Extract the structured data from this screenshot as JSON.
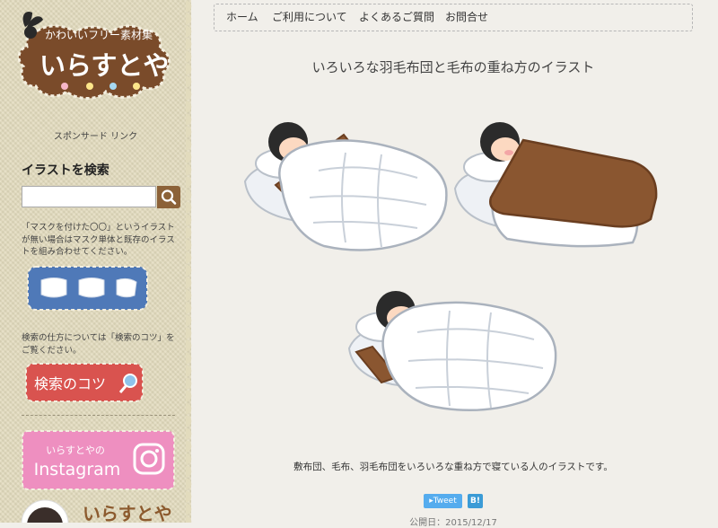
{
  "sidebar": {
    "logo": {
      "tagline": "かわいいフリー素材集",
      "title": "いらすとや"
    },
    "sponsored_link": "スポンサード リンク",
    "search_heading": "イラストを検索",
    "search_placeholder": "",
    "mask_note": "「マスクを付けた〇〇」というイラストが無い場合はマスク単体と既存のイラストを組み合わせてください。",
    "search_tip_note": "検索の仕方については「検索のコツ」をご覧ください。",
    "kotsu_banner": "検索のコツ",
    "instagram_banner": {
      "subtitle": "いらすとやの",
      "title": "Instagram"
    },
    "profile_banner": "いらすとや"
  },
  "nav": {
    "items": [
      {
        "label": "ホーム"
      },
      {
        "label": "ご利用について"
      },
      {
        "label": "よくあるご質問"
      },
      {
        "label": "お問合せ"
      }
    ]
  },
  "main": {
    "title": "いろいろな羽毛布団と毛布の重ね方のイラスト",
    "description": "敷布団、毛布、羽毛布団をいろいろな重ね方で寝ている人のイラストです。",
    "share": {
      "tweet": "Tweet",
      "hatena": "B!"
    },
    "published": "公開日：2015/12/17"
  },
  "colors": {
    "sidebar_bg": "#e2dbbd",
    "logo_brown": "#7a4b2a",
    "search_button": "#8c6238",
    "tweet_blue": "#55acee",
    "instagram_pink": "#ee8fc0",
    "blanket_brown": "#8a5630",
    "futon_white": "#ffffff"
  }
}
